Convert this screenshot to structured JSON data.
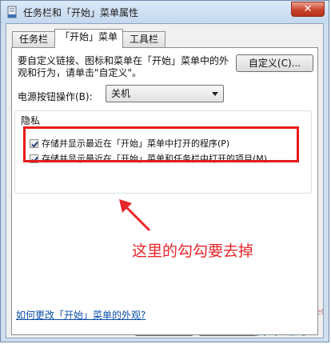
{
  "window": {
    "title": "任务栏和「开始」菜单属性",
    "close_label": "✕"
  },
  "tabs": [
    {
      "label": "任务栏",
      "active": false
    },
    {
      "label": "「开始」菜单",
      "active": true
    },
    {
      "label": "工具栏",
      "active": false
    }
  ],
  "panel": {
    "description": "要自定义链接、图标和菜单在「开始」菜单中的外观和行为，请单击\"自定义\"。",
    "customize_label": "自定义(C)...",
    "power_label": "电源按钮操作(B):",
    "power_value": "关机",
    "privacy_title": "隐私",
    "checkboxes": [
      {
        "label": "存储并显示最近在「开始」菜单中打开的程序(P)",
        "checked": true
      },
      {
        "label": "存储并显示最近在「开始」菜单和任务栏中打开的项目(M)",
        "checked": true
      }
    ],
    "help_link": "如何更改「开始」菜单的外观?"
  },
  "annotation": {
    "text": "这里的勾勾要去掉",
    "color": "#e8262b"
  },
  "buttons": {
    "ok_label": "确定",
    "cancel_label": "取"
  },
  "watermark": {
    "domain": "jb51.net",
    "brand": "脚本之家"
  },
  "colors": {
    "highlight_box": "#e61b1b",
    "link": "#0a4fa8"
  }
}
